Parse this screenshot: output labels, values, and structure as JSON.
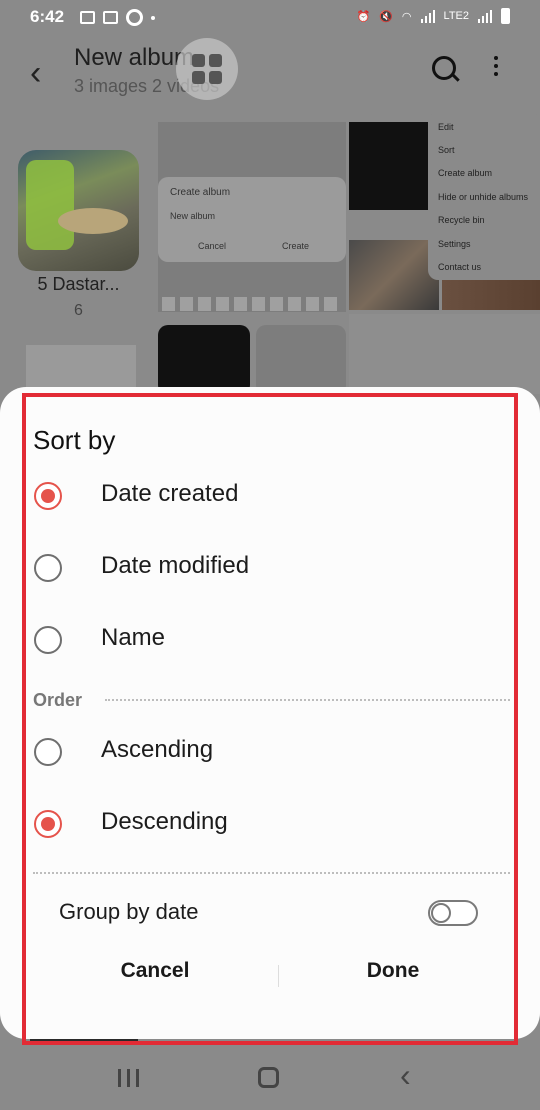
{
  "status_bar": {
    "time": "6:42",
    "network_label": "LTE2"
  },
  "header": {
    "title": "New album",
    "subtitle": "3 images 2 videos",
    "search_icon": "search-icon",
    "more_icon": "more-vert-icon"
  },
  "background": {
    "album_name": "5 Dastar...",
    "album_count": "6",
    "dialog_title": "Create album",
    "dialog_field": "New album",
    "dialog_cancel": "Cancel",
    "dialog_create": "Create",
    "menu_items": [
      "Edit",
      "Sort",
      "Create album",
      "Hide or unhide albums",
      "Recycle bin",
      "Settings",
      "Contact us"
    ]
  },
  "sort_sheet": {
    "title": "Sort by",
    "sort_options": [
      {
        "label": "Date created",
        "selected": true
      },
      {
        "label": "Date modified",
        "selected": false
      },
      {
        "label": "Name",
        "selected": false
      }
    ],
    "order_label": "Order",
    "order_options": [
      {
        "label": "Ascending",
        "selected": false
      },
      {
        "label": "Descending",
        "selected": true
      }
    ],
    "group_by_date_label": "Group by date",
    "group_by_date_on": false,
    "cancel_label": "Cancel",
    "done_label": "Done"
  },
  "colors": {
    "accent": "#e5534b",
    "highlight_border": "#e22b35"
  }
}
